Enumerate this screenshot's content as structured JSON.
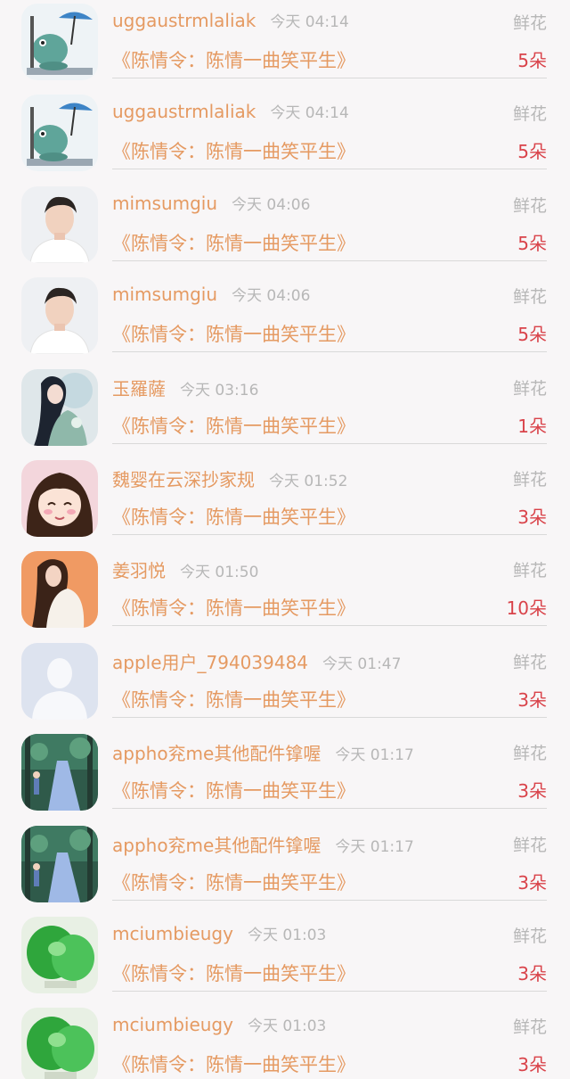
{
  "gift_label": "鲜花",
  "records": [
    {
      "name": "uggaustrmlaliak",
      "time": "今天 04:14",
      "book": "《陈情令：陈情一曲笑平生》",
      "count": "5朵",
      "avatar": "dinosaur-umbrella"
    },
    {
      "name": "uggaustrmlaliak",
      "time": "今天 04:14",
      "book": "《陈情令：陈情一曲笑平生》",
      "count": "5朵",
      "avatar": "dinosaur-umbrella"
    },
    {
      "name": "mimsumgiu",
      "time": "今天 04:06",
      "book": "《陈情令：陈情一曲笑平生》",
      "count": "5朵",
      "avatar": "young-man"
    },
    {
      "name": "mimsumgiu",
      "time": "今天 04:06",
      "book": "《陈情令：陈情一曲笑平生》",
      "count": "5朵",
      "avatar": "young-man"
    },
    {
      "name": "玉羅薩",
      "time": "今天 03:16",
      "book": "《陈情令：陈情一曲笑平生》",
      "count": "1朵",
      "avatar": "fantasy-woman"
    },
    {
      "name": "魏婴在云深抄家规",
      "time": "今天 01:52",
      "book": "《陈情令：陈情一曲笑平生》",
      "count": "3朵",
      "avatar": "anime-girl"
    },
    {
      "name": "姜羽悦",
      "time": "今天 01:50",
      "book": "《陈情令：陈情一曲笑平生》",
      "count": "10朵",
      "avatar": "woman-orange"
    },
    {
      "name": "apple用户_794039484",
      "time": "今天 01:47",
      "book": "《陈情令：陈情一曲笑平生》",
      "count": "3朵",
      "avatar": "default-user"
    },
    {
      "name": "appho兖me其他配件镎喔",
      "time": "今天 01:17",
      "book": "《陈情令：陈情一曲笑平生》",
      "count": "3朵",
      "avatar": "forest-path"
    },
    {
      "name": "appho兖me其他配件镎喔",
      "time": "今天 01:17",
      "book": "《陈情令：陈情一曲笑平生》",
      "count": "3朵",
      "avatar": "forest-path"
    },
    {
      "name": "mciumbieugy",
      "time": "今天 01:03",
      "book": "《陈情令：陈情一曲笑平生》",
      "count": "3朵",
      "avatar": "green-jade"
    },
    {
      "name": "mciumbieugy",
      "time": "今天 01:03",
      "book": "《陈情令：陈情一曲笑平生》",
      "count": "3朵",
      "avatar": "green-jade"
    }
  ]
}
